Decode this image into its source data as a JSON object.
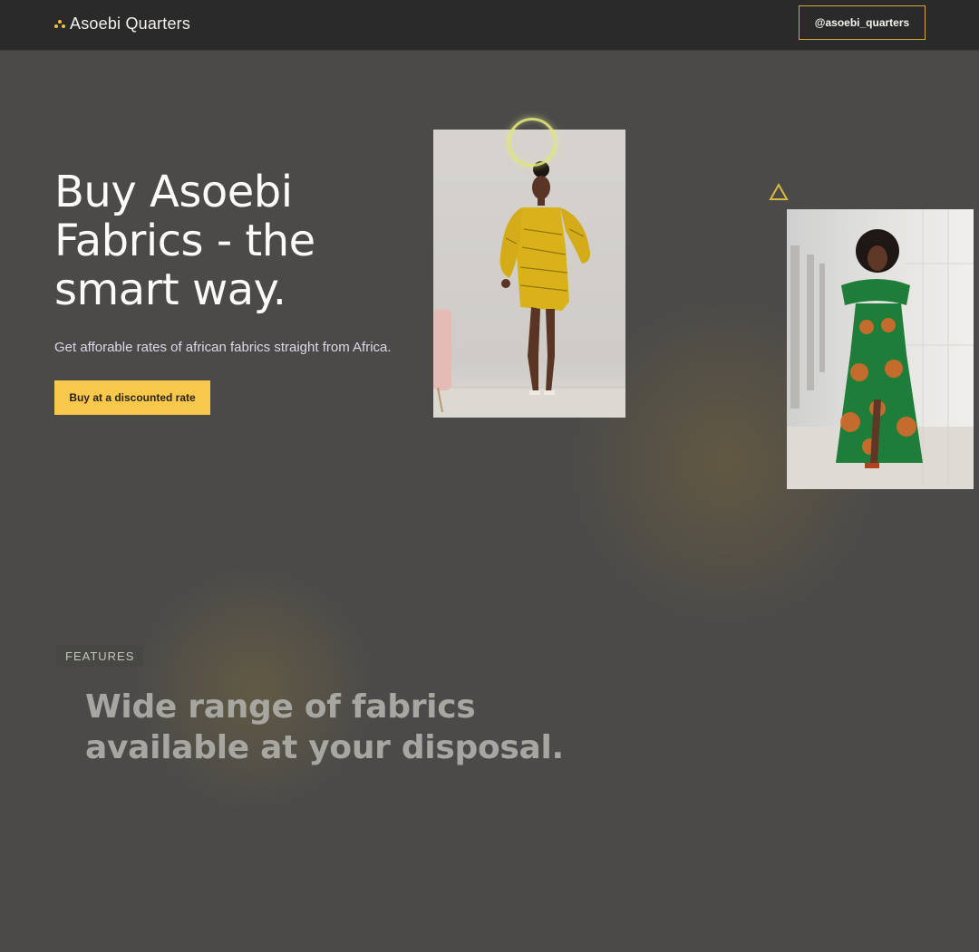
{
  "header": {
    "brand_name": "Asoebi Quarters",
    "handle_button": "@asoebi_quarters"
  },
  "hero": {
    "title": "Buy Asoebi Fabrics - the smart way.",
    "subtitle": "Get afforable rates of african fabrics straight from Africa.",
    "cta_label": "Buy at a discounted rate"
  },
  "features": {
    "tag": "FEATURES",
    "title": "Wide range of fabrics available at your disposal."
  },
  "icons": {
    "brand_logo": "three-dots-logo-icon",
    "ring_decoration": "glowing-ring-icon",
    "triangle_decoration": "triangle-outline-icon"
  },
  "colors": {
    "background": "#4b4a49",
    "header_bg": "#2a2a2a",
    "accent": "#f7c84b",
    "outline_accent": "#d4a93a"
  }
}
